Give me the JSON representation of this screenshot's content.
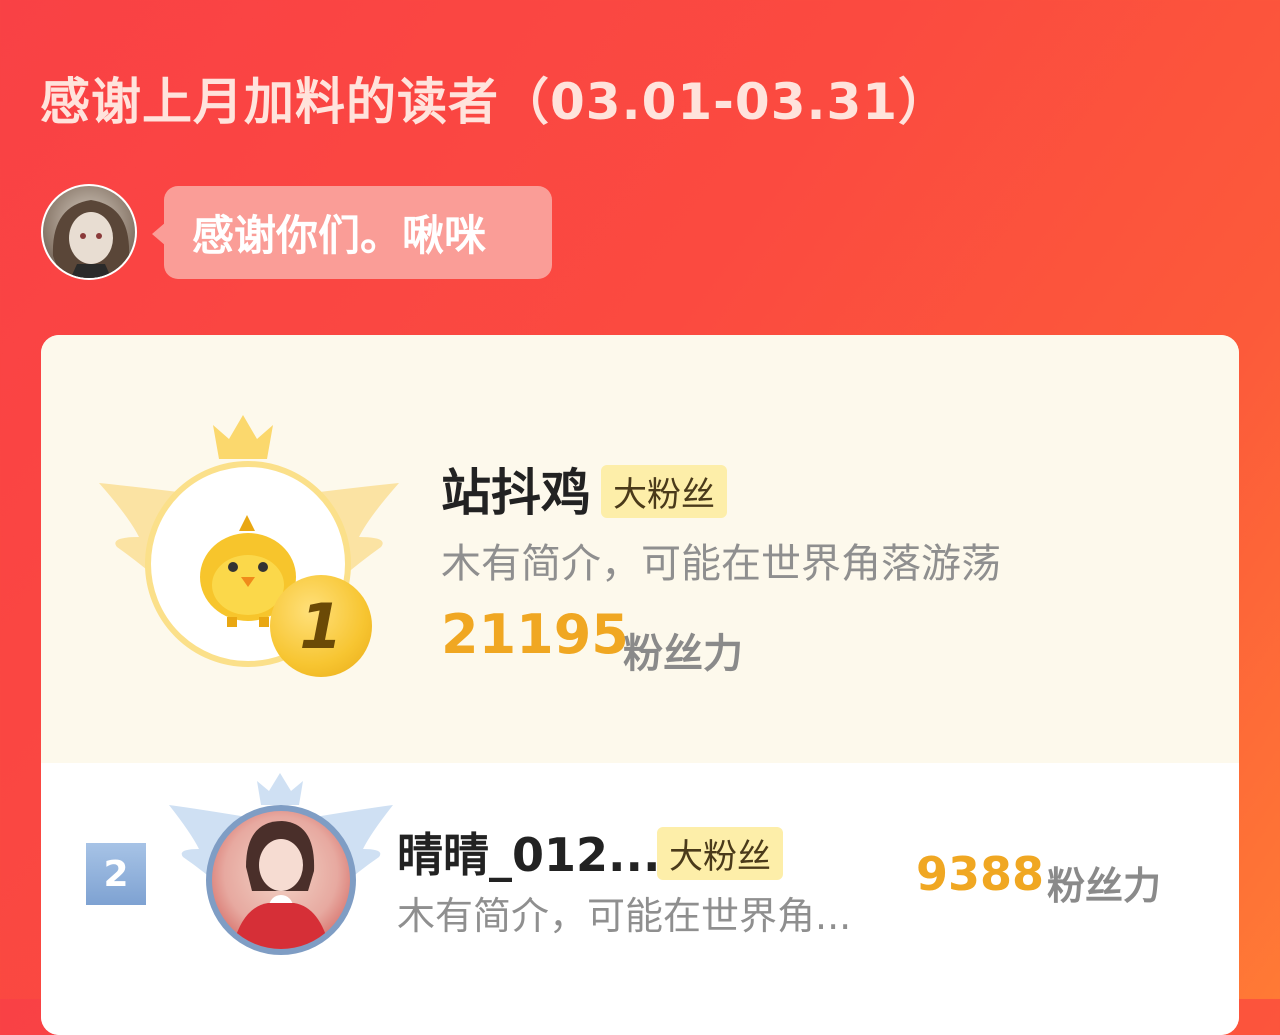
{
  "header": {
    "title": "感谢上月加料的读者（03.01-03.31）"
  },
  "author": {
    "message": "感谢你们。啾咪"
  },
  "ranking": [
    {
      "rank": "1",
      "name": "站抖鸡",
      "tag": "大粉丝",
      "bio": "木有简介，可能在世界角落游荡",
      "score": "21195",
      "unit": "粉丝力"
    },
    {
      "rank": "2",
      "name": "晴晴_012...",
      "tag": "大粉丝",
      "bio": "木有简介，可能在世界角...",
      "score": "9388",
      "unit": "粉丝力"
    }
  ],
  "colors": {
    "accent": "#f0a722",
    "background": "#f94145",
    "card_top": "#fdf9ec",
    "tag": "#fdeea9"
  }
}
